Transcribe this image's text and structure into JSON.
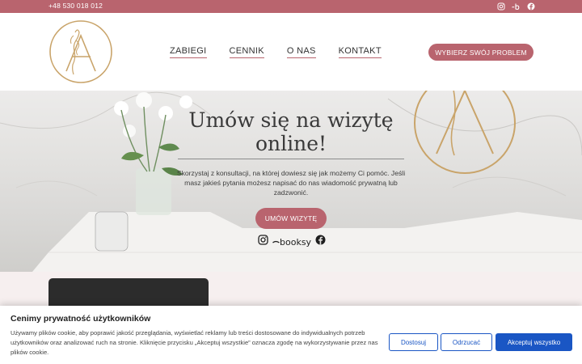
{
  "topbar": {
    "phone": "+48 530 018 012",
    "socials": [
      "instagram-icon",
      "booksy-icon",
      "facebook-icon"
    ]
  },
  "header": {
    "nav": [
      {
        "label": "ZABIEGI"
      },
      {
        "label": "CENNIK"
      },
      {
        "label": "O NAS"
      },
      {
        "label": "KONTAKT"
      }
    ],
    "cta_label": "WYBIERZ SWÓJ PROBLEM"
  },
  "hero": {
    "title_line1": "Umów się na wizytę",
    "title_line2": "online!",
    "text": "Skorzystaj z konsultacji, na której dowiesz się jak możemy Ci pomóc. Jeśli masz jakieś pytania możesz napisać do nas wiadomość prywatną lub zadzwonić.",
    "button_label": "UMÓW WIZYTĘ",
    "booksy_label": "booksy"
  },
  "cookie": {
    "title": "Cenimy prywatność użytkowników",
    "text": "Używamy plików cookie, aby poprawić jakość przeglądania, wyświetlać reklamy lub treści dostosowane do indywidualnych potrzeb użytkowników oraz analizować ruch na stronie. Kliknięcie przycisku „Akceptuj wszystkie” oznacza zgodę na wykorzystywanie przez nas plików cookie.",
    "customize_label": "Dostosuj",
    "reject_label": "Odrzucać",
    "accept_label": "Akceptuj wszystko"
  },
  "colors": {
    "accent": "#b9646e",
    "gold": "#c9a46a",
    "cookie_blue": "#1a56c4"
  }
}
